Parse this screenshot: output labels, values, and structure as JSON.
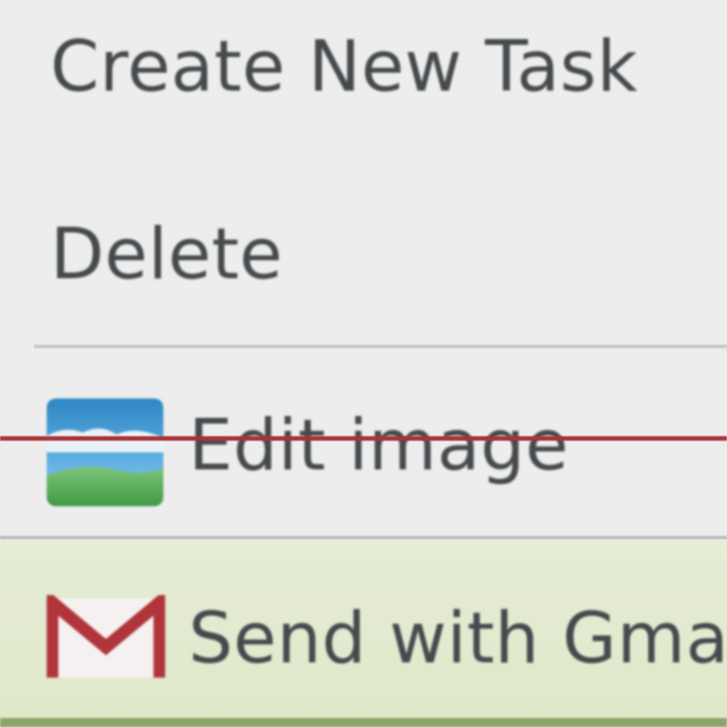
{
  "context_menu": {
    "items": [
      {
        "label": "Create New Task"
      },
      {
        "label": "Delete"
      },
      {
        "label": "Edit image",
        "icon": "image-icon"
      },
      {
        "label": "Send with Gmail",
        "icon": "gmail-icon"
      }
    ]
  },
  "colors": {
    "menu_background": "#ededed",
    "text": "#454a4d",
    "divider": "#c8c8c8",
    "strike_line": "#a8333b",
    "highlight_background": "#e3ead0",
    "gmail_red": "#b0353a"
  }
}
